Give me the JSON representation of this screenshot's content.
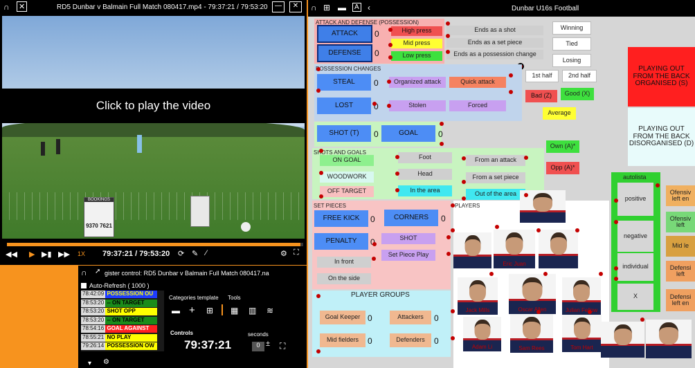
{
  "video": {
    "title": "RD5 Dunbar v Balmain Full Match 080417.mp4 - 79:37:21 / 79:53:20",
    "overlay": "Click to play the video",
    "time": "79:37:21 / 79:53:20",
    "speed": "1X",
    "sign_title": "BOOKINGS",
    "sign_phone": "9370 7621"
  },
  "register": {
    "title": "gister control: RD5 Dunbar v Balmain Full Match 080417.na",
    "auto_refresh": "Auto-Refresh  ( 1000 )",
    "categories_label": "Categories template",
    "tools_label": "Tools",
    "controls_label": "Controls",
    "seconds_label": "seconds",
    "controls_time": "79:37:21",
    "seconds_value": "0",
    "rows": [
      {
        "time": "78:42:09",
        "label": "POSSESSION OU",
        "color": "#1e3cff",
        "text": "#ffff00"
      },
      {
        "time": "78:53:20",
        "label": "-- ON TARGET",
        "color": "#1a8c1a",
        "text": "#000000"
      },
      {
        "time": "78:53:20",
        "label": "SHOT OPP",
        "color": "#ffff00",
        "text": "#000000"
      },
      {
        "time": "78:53:20",
        "label": "-- ON TARGET",
        "color": "#1a8c1a",
        "text": "#000000"
      },
      {
        "time": "78:54:16",
        "label": "GOAL AGAINST",
        "color": "#ff2020",
        "text": "#ffffff"
      },
      {
        "time": "78:55:21",
        "label": "NO PLAY",
        "color": "#ffff00",
        "text": "#000000"
      },
      {
        "time": "79:26:14",
        "label": "POSSESSION OW",
        "color": "#ffff00",
        "text": "#000000"
      }
    ]
  },
  "board": {
    "title": "Dunbar U16s Football",
    "attack_defense_title": "ATTACK AND DEFENSE (POSSESSION)",
    "attack": "ATTACK",
    "defense": "DEFENSE",
    "attack_val": "0",
    "defense_val": "0",
    "high_press": "High press",
    "mid_press": "Mid press",
    "low_press": "Low press",
    "ends_shot": "Ends as a shot",
    "ends_set_piece": "Ends as a set piece",
    "ends_possession": "Ends as a possession change",
    "winning": "Winning",
    "tied": "Tied",
    "losing": "Losing",
    "first_half": "1st half",
    "second_half": "2nd half",
    "bad": "Bad (Z)",
    "good": "Good (X)",
    "average": "Average",
    "own": "Own (A)*",
    "opp": "Opp (A)*",
    "possession_changes_title": "POSSESSION CHANGES",
    "steal": "STEAL",
    "lost": "LOST",
    "steal_val": "0",
    "lost_val": "0",
    "organized_attack": "Organized attack",
    "quick_attack": "Quick attack",
    "stolen": "Stolen",
    "forced": "Forced",
    "shot_t": "SHOT (T)",
    "goal": "GOAL",
    "shot_val": "0",
    "goal_val": "0",
    "shots_goals_title": "SHOTS AND GOALS",
    "on_goal": "ON GOAL",
    "woodwork": "WOODWORK",
    "off_target": "OFF TARGET",
    "foot": "Foot",
    "head": "Head",
    "in_area": "In the area",
    "from_attack": "From an attack",
    "from_set_piece": "From a set piece",
    "out_area": "Out of the area",
    "set_pieces_title": "SET PIECES",
    "free_kick": "FREE KICK",
    "corners": "CORNERS",
    "penalty": "PENALTY",
    "free_kick_val": "0",
    "corners_val": "0",
    "penalty_val": "0",
    "shot": "SHOT",
    "set_piece_play": "Set Piece Play",
    "in_front": "In front",
    "on_side": "On the side",
    "player_groups_title": "PLAYER GROUPS",
    "goal_keeper": "Goal Keeper",
    "attackers": "Attackers",
    "midfielders": "Mid fielders",
    "defenders": "Defenders",
    "gk_val": "0",
    "att_val": "0",
    "mid_val": "0",
    "def_val": "0",
    "players_title": "PLAYERS",
    "playing_out_org": "PLAYING OUT FROM THE BACK ORGANISED (S)",
    "playing_out_dis": "PLAYING OUT FROM THE BACK DISORGANISED (D)",
    "autolista": "autolista",
    "positive": "positive",
    "negative": "negative",
    "individual": "individual",
    "x": "X",
    "side_items": [
      "Ofensiv left en",
      "Ofensiv left",
      "Mid le",
      "Defensi left",
      "Defensi left en"
    ]
  },
  "players": [
    {
      "name": ""
    },
    {
      "name": ""
    },
    {
      "name": "Eric Juan"
    },
    {
      "name": ""
    },
    {
      "name": "Jack Mills"
    },
    {
      "name": "Oscar Allen"
    },
    {
      "name": "Julian Fellow"
    },
    {
      "name": "Adam Li"
    },
    {
      "name": "Sam Rees"
    },
    {
      "name": "Tom Hart"
    },
    {
      "name": ""
    },
    {
      "name": ""
    }
  ]
}
